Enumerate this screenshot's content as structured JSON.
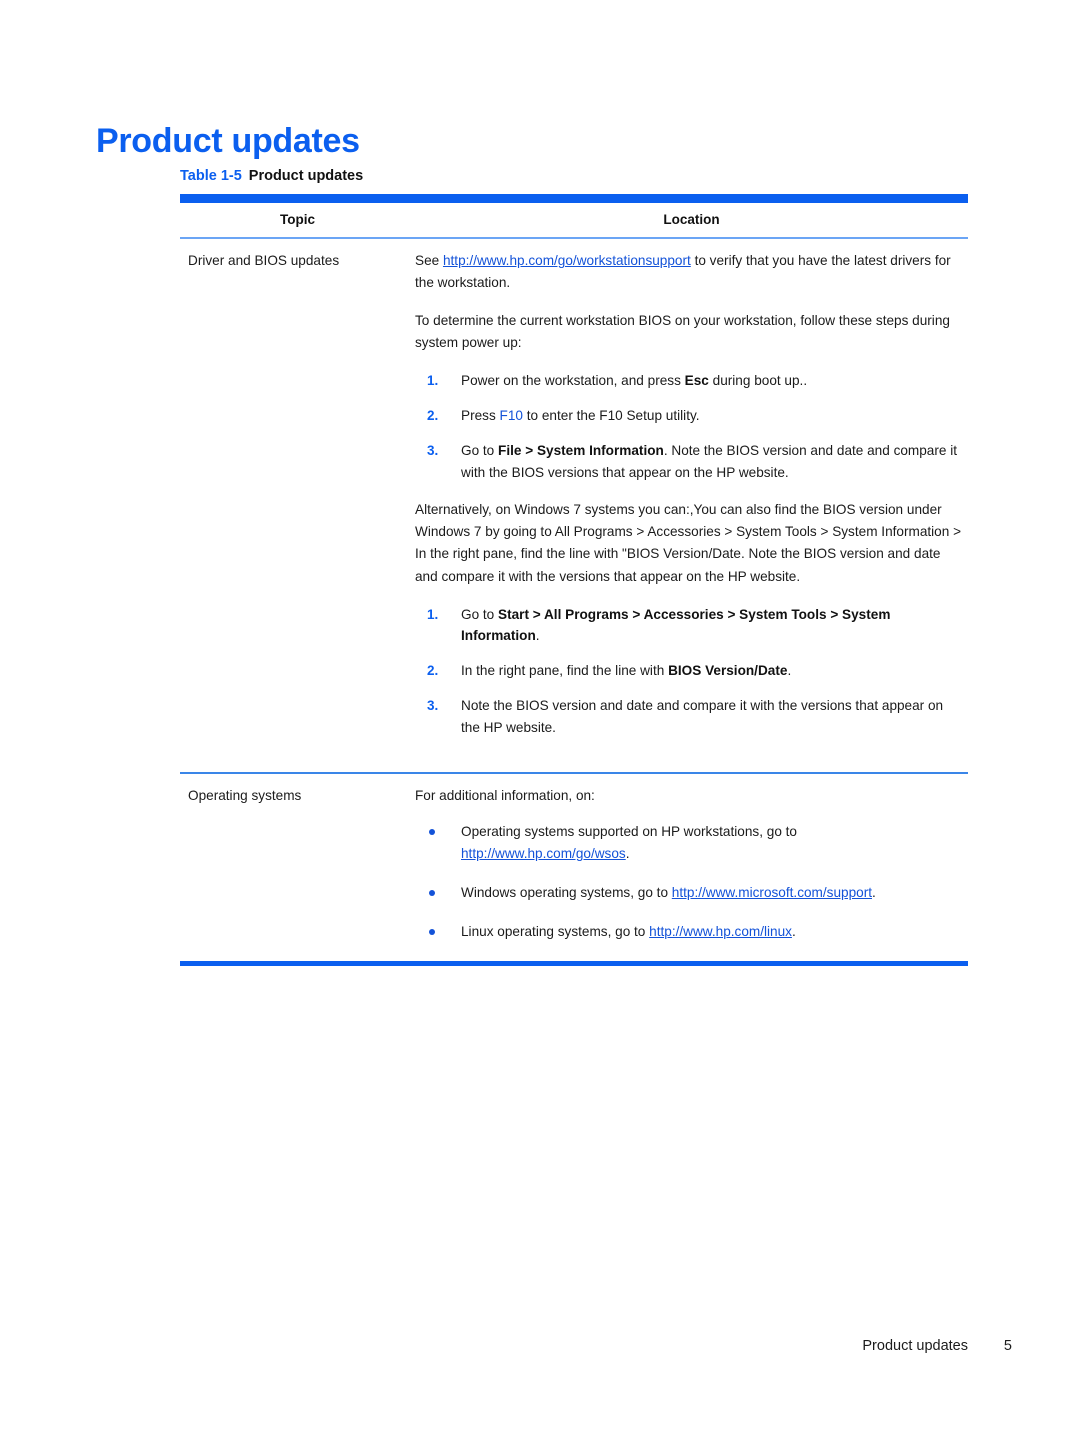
{
  "document": {
    "page_title": "Product updates"
  },
  "table": {
    "caption_number": "Table 1-5",
    "caption_title": "Product updates",
    "headers": {
      "topic": "Topic",
      "location": "Location"
    },
    "rows": [
      {
        "topic": "Driver and BIOS updates",
        "location": {
          "intro_before_link": "See ",
          "intro_link": "http://www.hp.com/go/workstationsupport",
          "intro_after_link": " to verify that you have the latest drivers for the workstation.",
          "lead_in": "To determine the current workstation BIOS on your workstation, follow these steps during system power up:",
          "steps_1": [
            {
              "num": "1.",
              "before_bold": "Power on the workstation, and press ",
              "bold": "Esc",
              "after_bold": " during boot up.."
            },
            {
              "num": "2.",
              "before_blue": "Press ",
              "blue": "F10",
              "after_blue": " to enter the F10 Setup utility."
            },
            {
              "num": "3.",
              "before_bold": "Go to ",
              "bold": "File > System Information",
              "after_bold": ". Note the BIOS version and date and compare it with the BIOS versions that appear on the HP website."
            }
          ],
          "alt_paragraph": "Alternatively, on Windows 7 systems you can:,You can also find the BIOS version under Windows 7 by going to All Programs > Accessories > System Tools > System Information > In the right pane, find the line with \"BIOS Version/Date. Note the BIOS version and date and compare it with the versions that appear on the HP website.",
          "steps_2": [
            {
              "num": "1.",
              "before_bold": "Go to ",
              "bold": "Start > All Programs > Accessories > System Tools > System Information",
              "after_bold": "."
            },
            {
              "num": "2.",
              "before_bold": "In the right pane, find the line with ",
              "bold": "BIOS Version/Date",
              "after_bold": "."
            },
            {
              "num": "3.",
              "before_bold": "Note the BIOS version and date and compare it with the versions that appear on the HP website.",
              "bold": "",
              "after_bold": ""
            }
          ]
        }
      },
      {
        "topic": "Operating systems",
        "location": {
          "lead_in": "For additional information, on:",
          "bullets": [
            {
              "before_link": "Operating systems supported on HP workstations, go to ",
              "link": "http://www.hp.com/go/wsos",
              "after_link": "."
            },
            {
              "before_link": "Windows operating systems, go to ",
              "link": "http://www.microsoft.com/support",
              "after_link": "."
            },
            {
              "before_link": "Linux operating systems, go to ",
              "link": "http://www.hp.com/linux",
              "after_link": "."
            }
          ]
        }
      }
    ]
  },
  "footer": {
    "title": "Product updates",
    "page_number": "5"
  },
  "colors": {
    "accent_blue": "#0B5FEF",
    "link_blue": "#1352D8",
    "rule_light_blue": "#6BA5F5",
    "rule_mid_blue": "#3A86E8",
    "body_text": "#1b1b1b"
  }
}
